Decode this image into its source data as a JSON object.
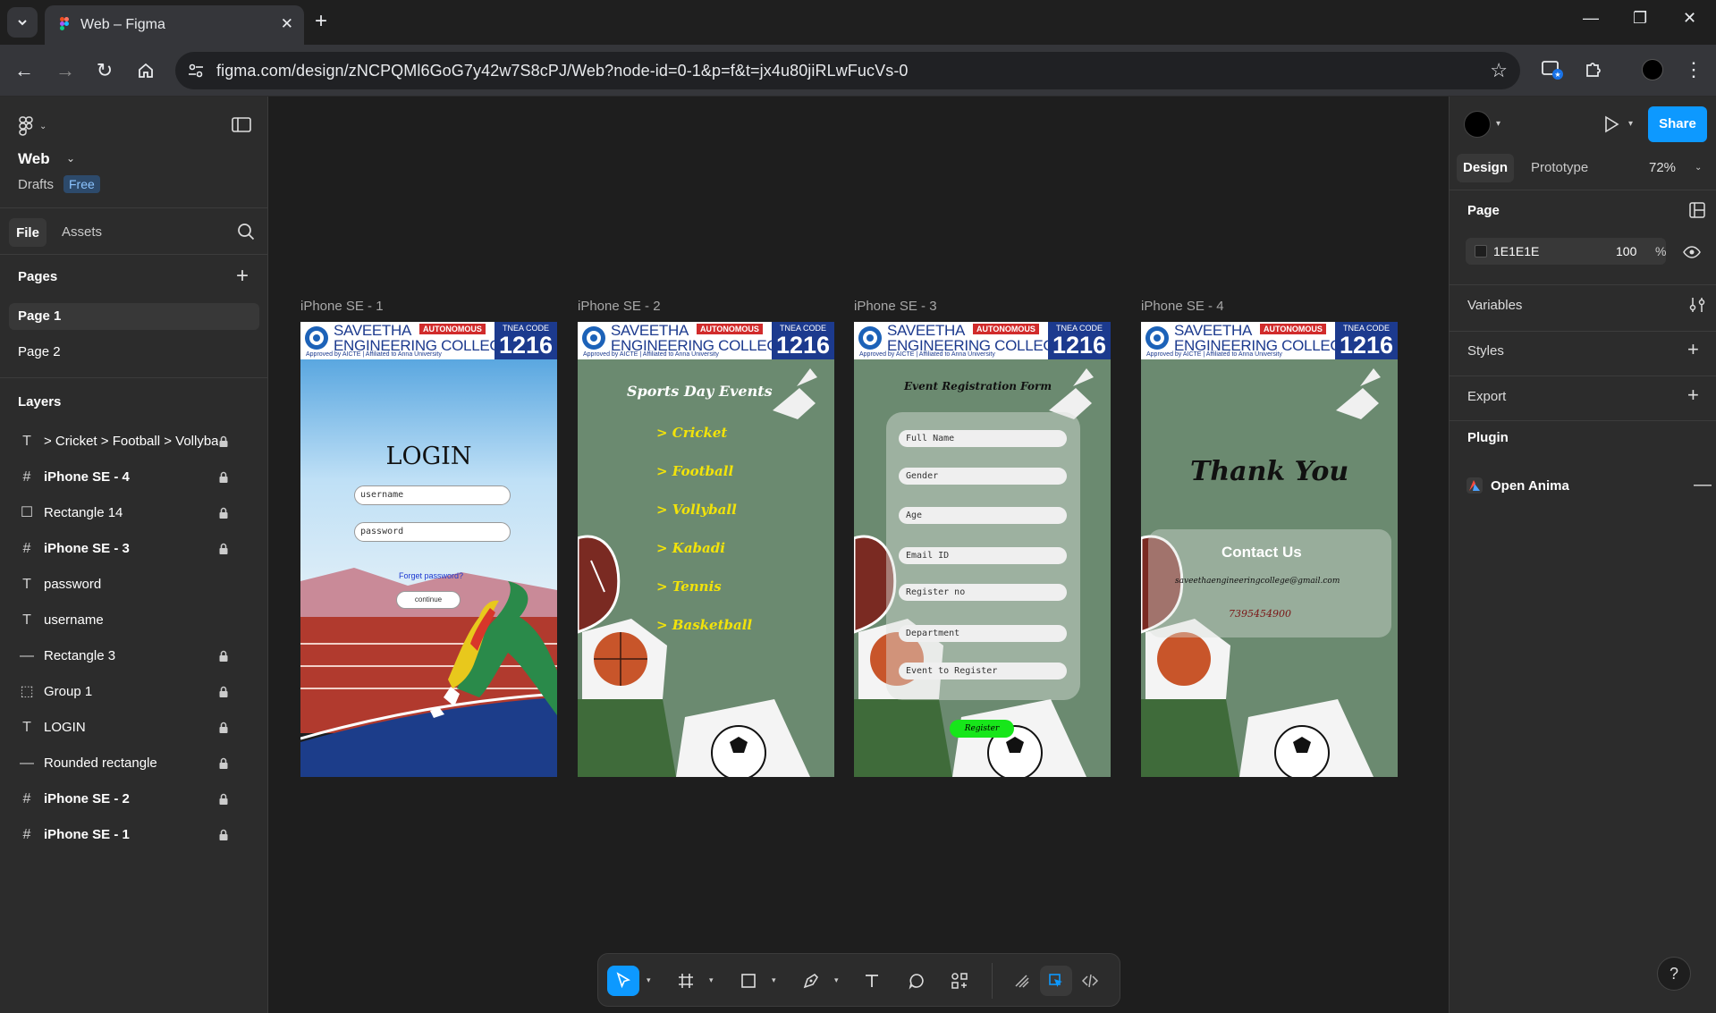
{
  "browser": {
    "tab_title": "Web – Figma",
    "url": "figma.com/design/zNCPQMl6GoG7y42w7S8cPJ/Web?node-id=0-1&p=f&t=jx4u80jiRLwFucVs-0"
  },
  "file": {
    "name": "Web",
    "location": "Drafts",
    "plan_badge": "Free"
  },
  "left_tabs": {
    "file": "File",
    "assets": "Assets"
  },
  "pages": {
    "heading": "Pages",
    "items": [
      {
        "label": "Page 1",
        "active": true
      },
      {
        "label": "Page 2",
        "active": false
      }
    ]
  },
  "layers": {
    "heading": "Layers",
    "items": [
      {
        "label": "> Cricket > Football > Vollybal",
        "icon": "text-icon",
        "locked": true
      },
      {
        "label": "iPhone SE - 4",
        "icon": "frame-icon",
        "locked": true
      },
      {
        "label": "Rectangle 14",
        "icon": "rectangle-icon",
        "locked": true
      },
      {
        "label": "iPhone SE - 3",
        "icon": "frame-icon",
        "locked": true
      },
      {
        "label": "password",
        "icon": "text-icon",
        "locked": false
      },
      {
        "label": "username",
        "icon": "text-icon",
        "locked": false
      },
      {
        "label": "Rectangle 3",
        "icon": "line-icon",
        "locked": true
      },
      {
        "label": "Group 1",
        "icon": "group-icon",
        "locked": true
      },
      {
        "label": "LOGIN",
        "icon": "text-icon",
        "locked": true
      },
      {
        "label": "Rounded rectangle",
        "icon": "line-icon",
        "locked": true
      },
      {
        "label": "iPhone SE - 2",
        "icon": "frame-icon",
        "locked": true
      },
      {
        "label": "iPhone SE - 1",
        "icon": "frame-icon",
        "locked": true
      }
    ]
  },
  "college": {
    "name_line1": "SAVEETHA",
    "name_line2": "ENGINEERING COLLEGE",
    "autonomous": "AUTONOMOUS",
    "approved": "Approved by AICTE | Affiliated to Anna University",
    "tnea_label": "TNEA CODE",
    "tnea_code": "1216"
  },
  "frames": [
    {
      "label": "iPhone SE - 1"
    },
    {
      "label": "iPhone SE - 2"
    },
    {
      "label": "iPhone SE - 3"
    },
    {
      "label": "iPhone SE - 4"
    }
  ],
  "login": {
    "title": "LOGIN",
    "username_placeholder": "username",
    "password_placeholder": "password",
    "forgot": "Forget password?",
    "continue": "continue"
  },
  "events": {
    "title": "Sports Day Events",
    "items": [
      "> Cricket",
      "> Football",
      "> Vollyball",
      "> Kabadi",
      "> Tennis",
      "> Basketball"
    ]
  },
  "registration": {
    "title": "Event Registration Form",
    "fields": [
      "Full Name",
      "Gender",
      "Age",
      "Email ID",
      "Register no",
      "Department",
      "Event to Register"
    ],
    "button": "Register"
  },
  "thanks": {
    "title": "Thank You",
    "contact_heading": "Contact Us",
    "email": "saveethaengineeringcollege@gmail.com",
    "phone": "7395454900"
  },
  "right_panel": {
    "share": "Share",
    "tab_design": "Design",
    "tab_prototype": "Prototype",
    "zoom": "72%",
    "page_heading": "Page",
    "page_color": "1E1E1E",
    "page_opacity": "100",
    "opacity_unit": "%",
    "variables": "Variables",
    "styles": "Styles",
    "export": "Export",
    "plugin": "Plugin",
    "plugin_name": "Open Anima",
    "help": "?"
  },
  "colors": {
    "accent": "#0d99ff",
    "canvas": "#1e1e1e",
    "panel": "#2c2c2c",
    "frame_green": "#6b8a70",
    "event_yellow": "#f2e30a",
    "register_green": "#17e61a"
  }
}
